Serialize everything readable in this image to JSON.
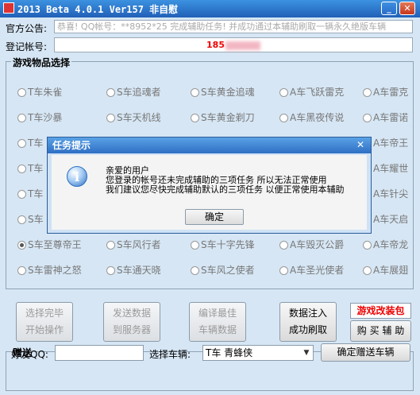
{
  "window": {
    "title": "2013 Beta 4.0.1 Ver157 非自慰"
  },
  "notice": {
    "label": "官方公告:",
    "text": "恭喜! QQ帐号：**8952*25 完成辅助任务! 并成功通过本辅助刷取一辆永久绝版车辆"
  },
  "account": {
    "label": "登记帐号:",
    "value": "185"
  },
  "items_group": {
    "title": "游戏物品选择",
    "items": [
      "T车朱雀",
      "S车追魂者",
      "S车黄金追魂",
      "A车飞跃雷克",
      "A车雷克",
      "T车沙暴",
      "S车天机线",
      "S车黄金剃刀",
      "A车黑夜传说",
      "A车雷诺",
      "T车",
      "",
      "",
      "",
      "A车帝王",
      "T车",
      "",
      "",
      "",
      "A车耀世",
      "T车",
      "",
      "",
      "",
      "A车针尖",
      "S车",
      "",
      "",
      "",
      "A车天启",
      "S车至尊帝王",
      "S车风行者",
      "S车十字先锋",
      "A车毁灭公爵",
      "A车帝龙",
      "S车雷神之怒",
      "S车通天晓",
      "S车风之使者",
      "A车圣光使者",
      "A车展翅"
    ],
    "selected": "S车至尊帝王"
  },
  "actions": [
    {
      "line1": "选择完毕",
      "line2": "开始操作"
    },
    {
      "line1": "发送数据",
      "line2": "到服务器"
    },
    {
      "line1": "编译最佳",
      "line2": "车辆数据"
    },
    {
      "line1": "数据注入",
      "line2": "成功刷取"
    }
  ],
  "upgrade_label": "游戏改装包",
  "buy_label": "购 买 辅 助",
  "gift_group": {
    "title": "赠送",
    "friend_qq_label": "好友QQ:",
    "friend_qq_value": "",
    "vehicle_label": "选择车辆:",
    "vehicle_value": "T车 青蜂侠",
    "confirm_label": "确定赠送车辆"
  },
  "dialog": {
    "title": "任务提示",
    "line1": "亲爱的用户",
    "line2": "您登录的帐号还未完成辅助的三项任务 所以无法正常使用",
    "line3": "我们建议您尽快完成辅助默认的三项任务 以便正常使用本辅助",
    "ok_label": "确定"
  }
}
